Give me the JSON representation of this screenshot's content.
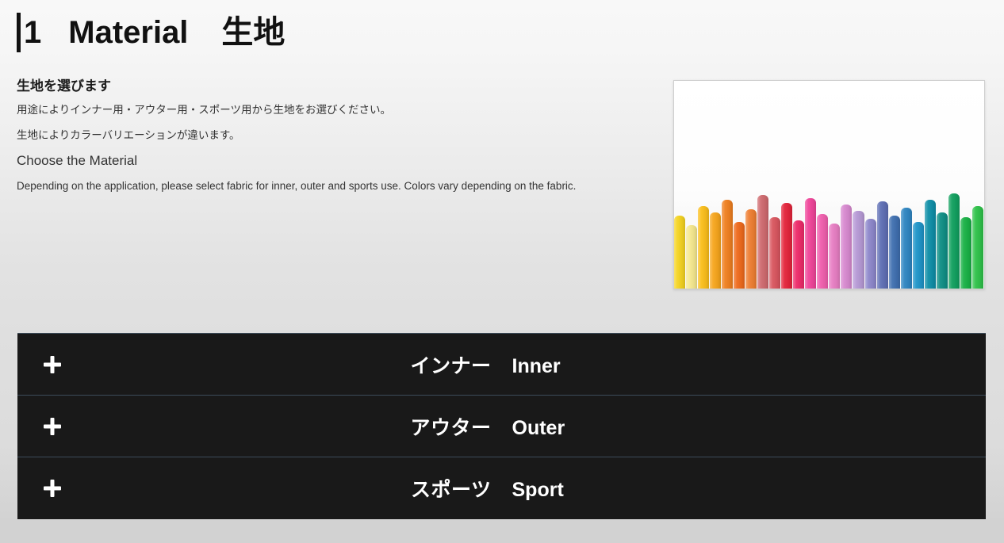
{
  "title": {
    "bar_icon": "vertical-bar-accent",
    "number": "1",
    "english": "Material",
    "japanese": "生地"
  },
  "intro": {
    "heading_jp": "生地を選びます",
    "line1_jp": "用途によりインナー用・アウター用・スポーツ用から生地をお選びください。",
    "line2_jp": "生地によりカラーバリエーションが違います。",
    "heading_en": "Choose the Material",
    "line1_en": "Depending on the application, please select fabric for inner, outer and sports use. Colors vary depending on the fabric."
  },
  "photo": {
    "alt": "rolls-of-colorful-fabric",
    "roll_colors": [
      "#f5d421",
      "#f6e98f",
      "#fbbf1c",
      "#f7a61d",
      "#f08020",
      "#ef6a1b",
      "#ef7f32",
      "#cf6a6f",
      "#d9565f",
      "#e4243b",
      "#ee2b6a",
      "#f0459a",
      "#f15fae",
      "#e87fc4",
      "#d88ad0",
      "#b79ad6",
      "#8d87cb",
      "#5f6fb5",
      "#3f6fb0",
      "#2f86c2",
      "#1f95c9",
      "#0f8fa8",
      "#0f8f86",
      "#12a05f",
      "#19b246",
      "#2fc24a"
    ]
  },
  "accordion": {
    "rows": [
      {
        "icon": "plus-icon",
        "jp": "インナー",
        "en": "Inner"
      },
      {
        "icon": "plus-icon",
        "jp": "アウター",
        "en": "Outer"
      },
      {
        "icon": "plus-icon",
        "jp": "スポーツ",
        "en": "Sport"
      }
    ]
  },
  "colors": {
    "panel_background": "#191919",
    "panel_divider": "#3c4c5a",
    "page_background_top": "#f8f8f8",
    "page_background_bottom": "#d2d2d2",
    "text_primary": "#1b1b1b",
    "text_secondary": "#333333"
  }
}
